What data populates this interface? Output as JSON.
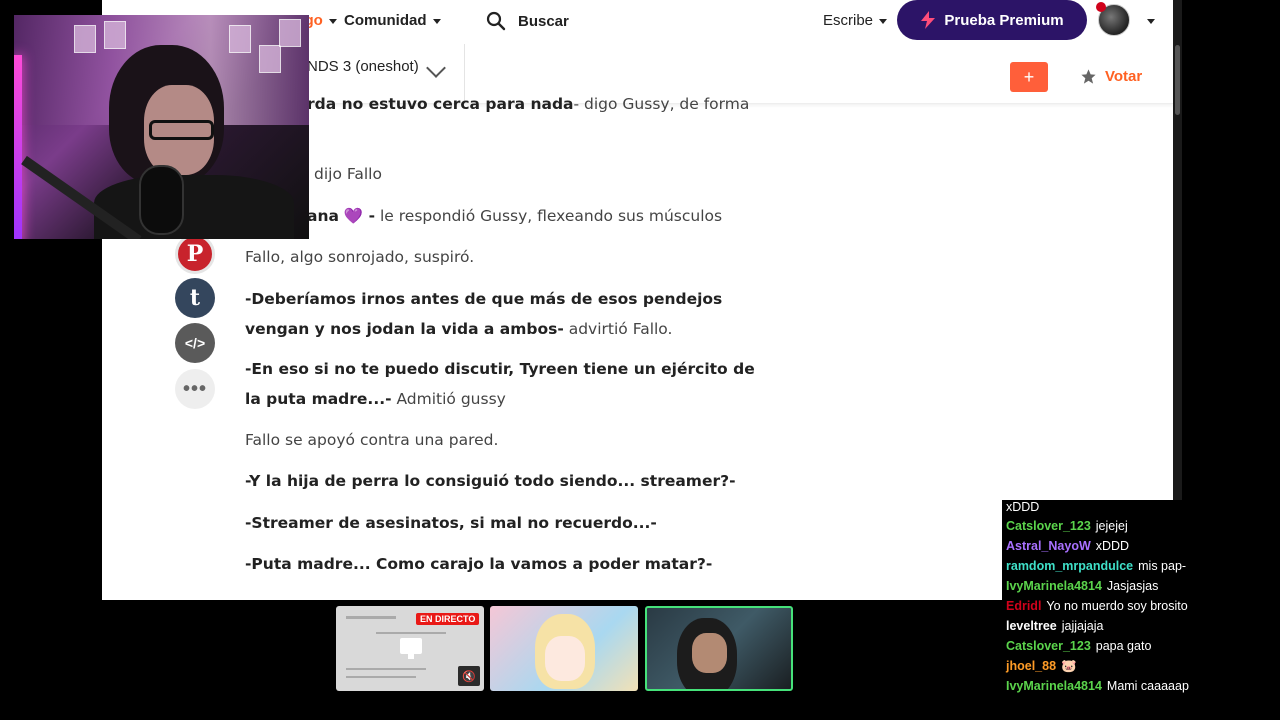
{
  "nav": {
    "category": "Catego",
    "community": "Comunidad",
    "search": "Buscar",
    "write": "Escribe",
    "premium": "Prueba Premium"
  },
  "story": {
    "title": "NDS 3 (oneshot)",
    "add": "+",
    "vote": "Votar"
  },
  "share": {
    "pinterest": "P",
    "tumblr": "t",
    "embed": "</>",
    "more": "•••"
  },
  "text": {
    "p0_bold": "rda no estuvo cerca para nada",
    "p0_rest": "- digo Gussy, de forma",
    "p1": "dijo Fallo",
    "p2_bold": "ana",
    "p2_emoji": "💜",
    "p2_dash": " -",
    "p2_rest": " le respondió Gussy, flexeando sus músculos",
    "p3": "Fallo, algo sonrojado, suspiró.",
    "p4_bold": "-Deberíamos irnos antes de que más de esos pendejos vengan y nos jodan la vida a ambos-",
    "p4_rest": " advirtió Fallo.",
    "p5_bold": "-En eso si no te puedo discutir, Tyreen tiene un ejército de la puta madre...-",
    "p5_rest": " Admitió gussy",
    "p6": "Fallo se apoyó contra una pared.",
    "p7_bold": "-Y la hija de perra lo consiguió todo siendo... streamer?-",
    "p8_bold": "-Streamer de asesinatos, si mal no recuerdo...-",
    "p9_bold": "-Puta madre... Como carajo la vamos a poder matar?-"
  },
  "chat": {
    "messages": [
      {
        "user": "",
        "text": "xDDD",
        "color": "#ffffff"
      },
      {
        "user": "Catslover_123",
        "text": "jejejej",
        "color": "#5bd44c"
      },
      {
        "user": "Astral_NayoW",
        "text": "xDDD",
        "color": "#a970ff"
      },
      {
        "user": "ramdom_mrpandulce",
        "text": "mis pap-",
        "color": "#3fe0c8"
      },
      {
        "user": "IvyMarinela4814",
        "text": "Jasjasjas",
        "color": "#5bd44c"
      },
      {
        "user": "Edridl",
        "text": "Yo no muerdo soy brosito",
        "color": "#d0021b"
      },
      {
        "user": "leveltree",
        "text": "jajjajaja",
        "color": "#ffffff"
      },
      {
        "user": "Catslover_123",
        "text": "papa gato",
        "color": "#5bd44c"
      },
      {
        "user": "jhoel_88",
        "text": "🐷",
        "color": "#ff9c27"
      },
      {
        "user": "IvyMarinela4814",
        "text": "Mami caaaaap",
        "color": "#5bd44c"
      }
    ]
  },
  "thumbs": {
    "live": "EN DIRECTO"
  },
  "colors": {
    "brand": "#ff6122",
    "premium": "#2c1467",
    "add_button": "#ff5f3a"
  }
}
